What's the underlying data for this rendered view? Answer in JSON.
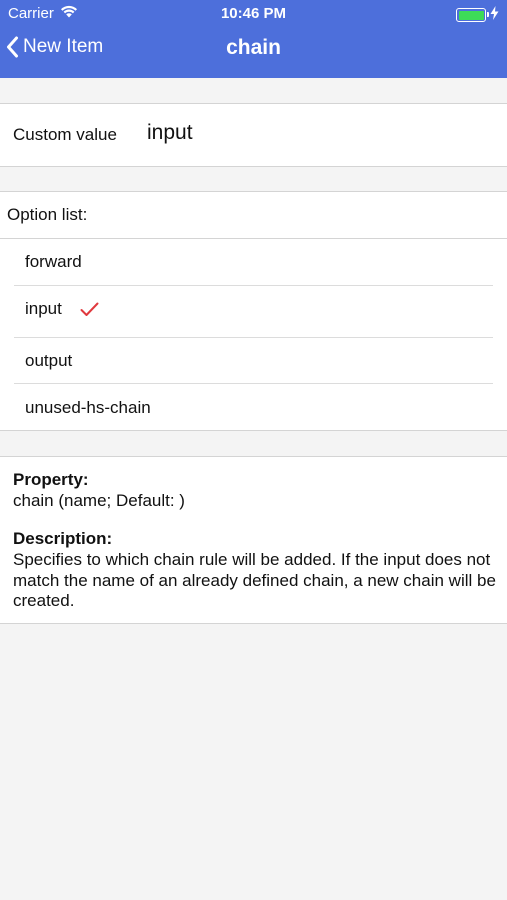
{
  "status_bar": {
    "carrier": "Carrier",
    "time": "10:46 PM",
    "battery_color": "#3ddc57"
  },
  "nav": {
    "back_label": "New Item",
    "title": "chain",
    "color": "#4d6fdb"
  },
  "custom_value": {
    "label": "Custom value",
    "value": "input"
  },
  "option_list": {
    "header": "Option list:",
    "items": [
      {
        "label": "forward",
        "selected": false
      },
      {
        "label": "input",
        "selected": true
      },
      {
        "label": "output",
        "selected": false
      },
      {
        "label": "unused-hs-chain",
        "selected": false
      }
    ],
    "check_color": "#e0393e"
  },
  "info": {
    "property_heading": "Property:",
    "property_value": "chain (name; Default: )",
    "description_heading": "Description:",
    "description_text": "Specifies to which chain rule will be added. If the input does not match the name of an already defined chain, a new chain will be created."
  }
}
